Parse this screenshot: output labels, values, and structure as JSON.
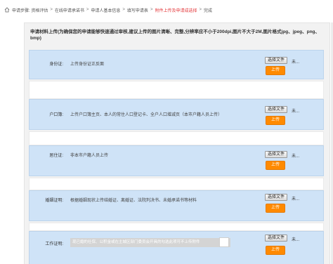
{
  "breadcrumb": {
    "items": [
      "申请步骤: 资格评估",
      "在线申请承诺书",
      "申请人基本信息",
      "填写申请表",
      "附件上传及申请成选择",
      "完成"
    ],
    "active_index": 4,
    "separator": ">"
  },
  "card": {
    "title": "申请材料上传(为确保您的申请能够快速通过审核,建议上传的图片清晰、完整,分辨率应不小于200dpi,图片不大于2M,图片格式jpg、jpeg、png、bmp)"
  },
  "rows": [
    {
      "label": "身份证:",
      "desc": "上传身份证正反面",
      "file_button": "选择文件",
      "file_status": "未...",
      "upload_button": "上传"
    },
    {
      "label": "户口簿:",
      "desc": "上传户口簿主页、本人的常住人口登记卡、全户人口增减页（本市户籍人员上传）",
      "file_button": "选择文件",
      "file_status": "未...",
      "upload_button": "上传"
    },
    {
      "label": "居住证:",
      "desc": "非本市户籍人员上传",
      "file_button": "选择文件",
      "file_status": "未...",
      "upload_button": "上传"
    },
    {
      "label": "婚姻证明:",
      "desc": "根据婚姻现状上传结婚证、离婚证、法院判决书、未婚承诺书等材料",
      "file_button": "选择文件",
      "file_status": "未...",
      "upload_button": "上传"
    },
    {
      "label": "工作证明:",
      "desc": "现已婚的社保、公积金或在主城区部门委员会开具的勾选此项可不上传附件",
      "file_button": "选择文件",
      "file_status": "未...",
      "upload_button": "上传"
    }
  ],
  "colors": {
    "row_bg": "#cfe3f7",
    "accent_orange": "#ff8a00",
    "active_crumb": "#e4393c"
  }
}
